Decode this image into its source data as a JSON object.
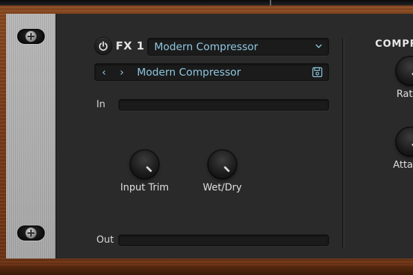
{
  "fx_slot": {
    "label": "FX 1",
    "effect_selected": "Modern Compressor",
    "preset_prev": "‹",
    "preset_next": "›",
    "preset_name": "Modern Compressor"
  },
  "meters": {
    "in_label": "In",
    "out_label": "Out"
  },
  "knobs": [
    {
      "label": "Input Trim"
    },
    {
      "label": "Wet/Dry"
    }
  ],
  "compressor_section": {
    "title": "COMPRESSOR",
    "knobs": [
      {
        "label": "Ratio"
      },
      {
        "label": "Attack"
      }
    ]
  },
  "colors": {
    "accent_text": "#8ec7e0",
    "panel": "#2a2a2a",
    "wood": "#7a3d1a"
  },
  "icons": [
    "power-icon",
    "chevron-down-icon",
    "save-icon",
    "screw-icon"
  ]
}
